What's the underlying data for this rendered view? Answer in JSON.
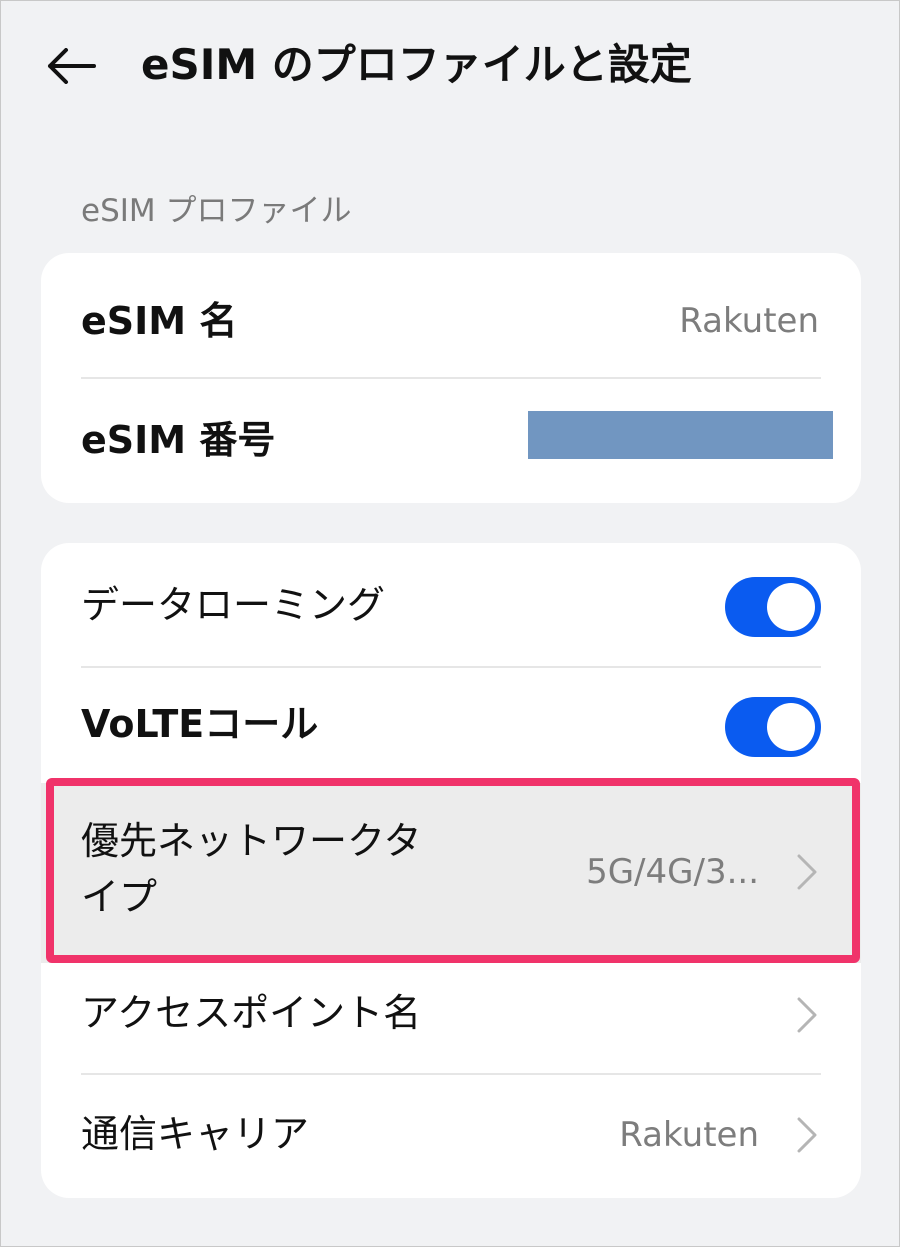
{
  "header": {
    "back_icon": "arrow-left-icon",
    "title": "eSIM のプロファイルと設定"
  },
  "profile_section": {
    "label": "eSIM プロファイル",
    "name_label": "eSIM 名",
    "name_value": "Rakuten",
    "number_label": "eSIM 番号"
  },
  "settings": {
    "data_roaming_label": "データローミング",
    "data_roaming_on": true,
    "volte_label": "VoLTEコール",
    "volte_on": true,
    "network_type_label_line1": "優先ネットワークタ",
    "network_type_label_line2": "イプ",
    "network_type_value": "5G/4G/3...",
    "apn_label": "アクセスポイント名",
    "carrier_label": "通信キャリア",
    "carrier_value": "Rakuten"
  },
  "colors": {
    "toggle_on": "#0a5bf0",
    "highlight_border": "#f0336a",
    "redaction": "#7196c1"
  }
}
